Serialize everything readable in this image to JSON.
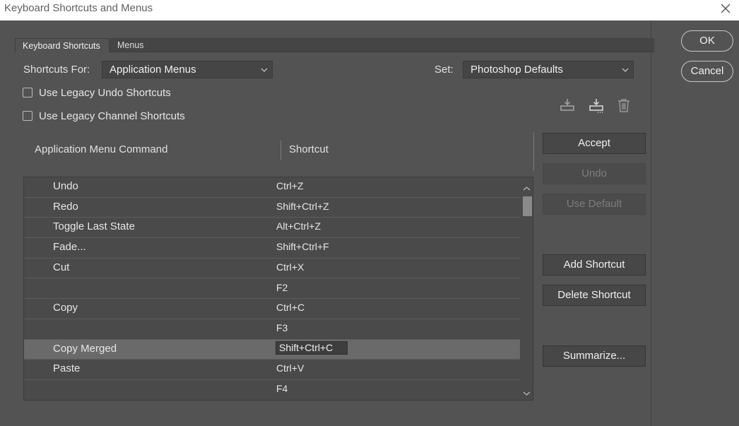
{
  "window": {
    "title": "Keyboard Shortcuts and Menus"
  },
  "tabs": [
    {
      "label": "Keyboard Shortcuts",
      "active": true
    },
    {
      "label": "Menus",
      "active": false
    }
  ],
  "shortcuts_for": {
    "label": "Shortcuts For:",
    "value": "Application Menus"
  },
  "set": {
    "label": "Set:",
    "value": "Photoshop Defaults"
  },
  "options": [
    {
      "label": "Use Legacy Undo Shortcuts",
      "checked": false
    },
    {
      "label": "Use Legacy Channel Shortcuts",
      "checked": false
    }
  ],
  "set_icons": [
    "save-set-icon",
    "save-set-as-icon",
    "delete-set-icon"
  ],
  "table": {
    "headers": {
      "command": "Application Menu Command",
      "shortcut": "Shortcut"
    },
    "rows": [
      {
        "command": "Undo",
        "shortcut": "Ctrl+Z"
      },
      {
        "command": "Redo",
        "shortcut": "Shift+Ctrl+Z"
      },
      {
        "command": "Toggle Last State",
        "shortcut": "Alt+Ctrl+Z"
      },
      {
        "command": "Fade...",
        "shortcut": "Shift+Ctrl+F"
      },
      {
        "command": "Cut",
        "shortcut": "Ctrl+X"
      },
      {
        "command": "",
        "shortcut": "F2"
      },
      {
        "command": "Copy",
        "shortcut": "Ctrl+C"
      },
      {
        "command": "",
        "shortcut": "F3"
      },
      {
        "command": "Copy Merged",
        "shortcut": "Shift+Ctrl+C",
        "selected": true
      },
      {
        "command": "Paste",
        "shortcut": "Ctrl+V"
      },
      {
        "command": "",
        "shortcut": "F4"
      }
    ]
  },
  "actions": {
    "accept": "Accept",
    "undo": "Undo",
    "use_default": "Use Default",
    "add_shortcut": "Add Shortcut",
    "delete_shortcut": "Delete Shortcut",
    "summarize": "Summarize..."
  },
  "dialog_buttons": {
    "ok": "OK",
    "cancel": "Cancel"
  },
  "colors": {
    "background": "#535353",
    "row_selected": "#6a6a6a",
    "table_bg": "#4a4a4a"
  }
}
